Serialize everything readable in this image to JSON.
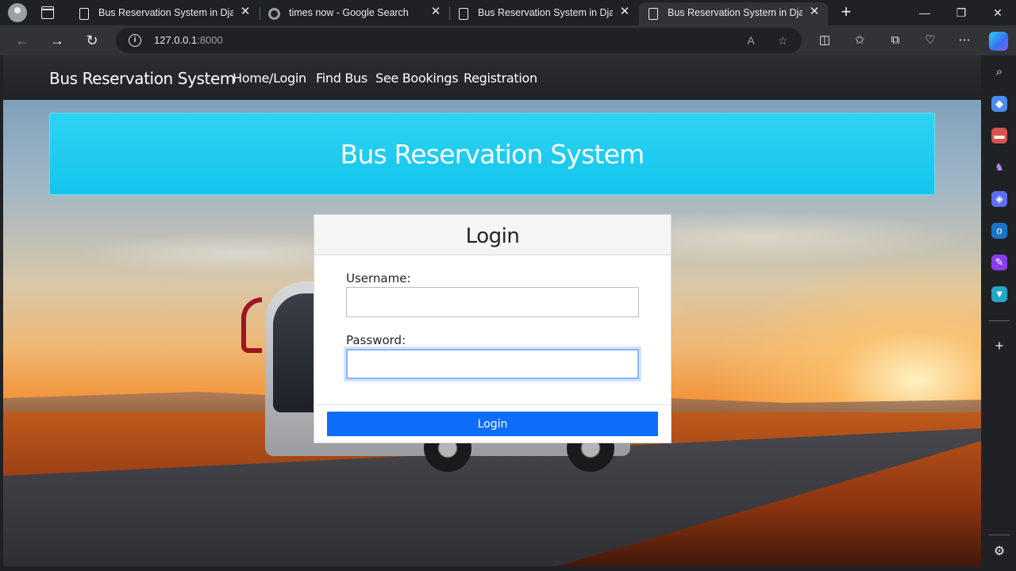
{
  "browser": {
    "tabs": [
      {
        "title": "Bus Reservation System in Djang",
        "active": false,
        "favicon": "page-icon"
      },
      {
        "title": "times now - Google Search",
        "active": false,
        "favicon": "google-icon"
      },
      {
        "title": "Bus Reservation System in Djang",
        "active": false,
        "favicon": "page-icon"
      },
      {
        "title": "Bus Reservation System in Djang",
        "active": true,
        "favicon": "page-icon"
      }
    ],
    "close_glyph": "✕",
    "url_host": "127.0.0.1",
    "url_port": ":8000"
  },
  "site": {
    "brand": "Bus Reservation System",
    "nav": [
      {
        "label": "Home/Login"
      },
      {
        "label": "Find Bus"
      },
      {
        "label": "See Bookings"
      },
      {
        "label": "Registration"
      }
    ],
    "banner_title": "Bus Reservation System",
    "login": {
      "title": "Login",
      "username_label": "Username:",
      "username_value": "",
      "password_label": "Password:",
      "password_value": "",
      "submit_label": "Login"
    }
  },
  "colors": {
    "banner": "#1ccaf0",
    "primary_button": "#0d6efd",
    "navbar": "#2b2d30"
  }
}
